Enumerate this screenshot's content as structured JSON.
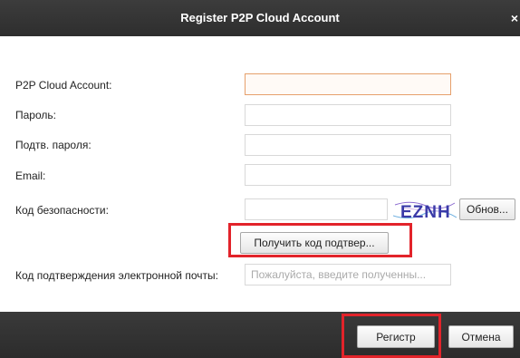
{
  "window": {
    "title": "Register P2P Cloud Account",
    "close_glyph": "×"
  },
  "form": {
    "account_label": "P2P Cloud Account:",
    "account_value": "",
    "password_label": "Пароль:",
    "confirm_label": "Подтв. пароля:",
    "email_label": "Email:",
    "security_label": "Код безопасности:",
    "security_value": "",
    "captcha_text": "EZNH",
    "refresh_label": "Обнов...",
    "get_code_label": "Получить код подтвер...",
    "email_code_label": "Код подтверждения электронной почты:",
    "email_code_placeholder": "Пожалуйста, введите полученны..."
  },
  "footer": {
    "register_label": "Регистр",
    "cancel_label": "Отмена"
  },
  "colors": {
    "highlight": "#e2232a",
    "focus_border": "#e6a06c",
    "titlebar": "#333333"
  }
}
